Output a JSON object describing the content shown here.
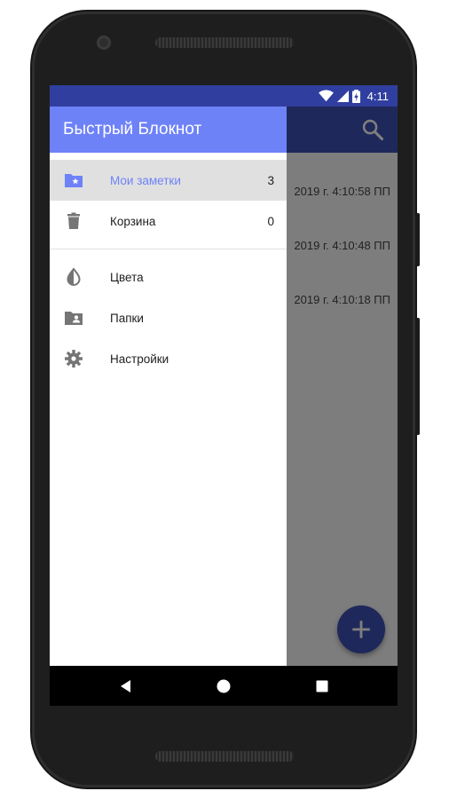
{
  "status": {
    "time": "4:11"
  },
  "app": {
    "notes": [
      {
        "date": "2019 г. 4:10:58 ПП"
      },
      {
        "date": "2019 г. 4:10:48 ПП"
      },
      {
        "date": "2019 г. 4:10:18 ПП"
      }
    ]
  },
  "drawer": {
    "title": "Быстрый Блокнот",
    "items": [
      {
        "label": "Мои заметки",
        "count": "3",
        "icon": "folder-star-icon"
      },
      {
        "label": "Корзина",
        "count": "0",
        "icon": "trash-icon"
      }
    ],
    "secondary": [
      {
        "label": "Цвета",
        "icon": "color-drop-icon"
      },
      {
        "label": "Папки",
        "icon": "folder-shared-icon"
      },
      {
        "label": "Настройки",
        "icon": "gear-icon"
      }
    ]
  },
  "colors": {
    "primary": "#3f51b5",
    "primary_dark": "#303f9f",
    "drawer_header": "#6e82f8",
    "active_bg": "#e0e0e0"
  }
}
